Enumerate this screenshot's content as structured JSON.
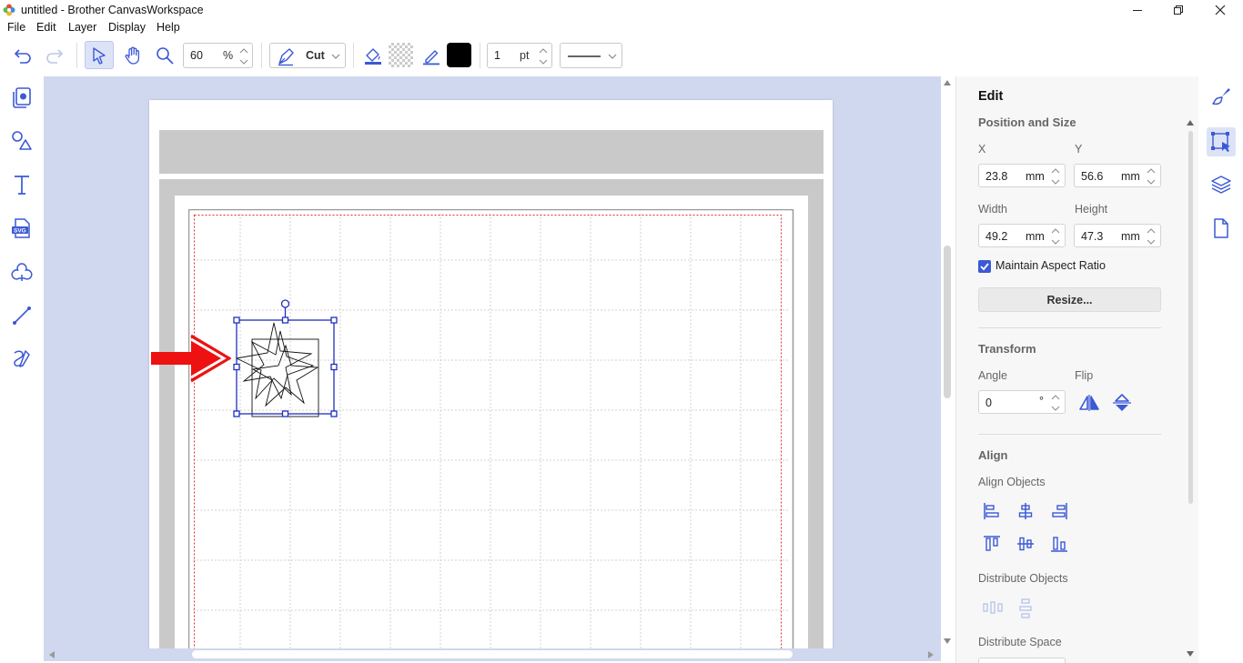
{
  "window": {
    "title": "untitled - Brother CanvasWorkspace"
  },
  "menu": {
    "items": [
      {
        "label": "File"
      },
      {
        "label": "Edit"
      },
      {
        "label": "Layer"
      },
      {
        "label": "Display"
      },
      {
        "label": "Help"
      }
    ]
  },
  "toolbar": {
    "zoom_value": "60",
    "zoom_unit": "%",
    "mode_label": "Cut",
    "line_width_value": "1",
    "line_width_unit": "pt",
    "line_color": "#000000",
    "accent_color": "#3b59d6"
  },
  "panel": {
    "title": "Edit",
    "position_size": {
      "heading": "Position and Size",
      "x_label": "X",
      "y_label": "Y",
      "x_value": "23.8",
      "y_value": "56.6",
      "width_label": "Width",
      "height_label": "Height",
      "width_value": "49.2",
      "height_value": "47.3",
      "unit": "mm",
      "maintain_aspect_label": "Maintain Aspect Ratio",
      "maintain_aspect_checked": true,
      "resize_label": "Resize..."
    },
    "transform": {
      "heading": "Transform",
      "angle_label": "Angle",
      "angle_value": "0",
      "angle_unit": "°",
      "flip_label": "Flip"
    },
    "align": {
      "heading": "Align",
      "align_objects_label": "Align Objects",
      "distribute_objects_label": "Distribute Objects",
      "distribute_space_label": "Distribute Space"
    }
  },
  "icons": {
    "left_tools": [
      "pages-icon",
      "shapes-icon",
      "text-icon",
      "svg-import-icon",
      "pattern-icon",
      "line-icon",
      "freehand-icon"
    ],
    "right_tools": [
      "paint-brush-icon",
      "edit-transform-icon",
      "layers-icon",
      "page-icon"
    ]
  }
}
